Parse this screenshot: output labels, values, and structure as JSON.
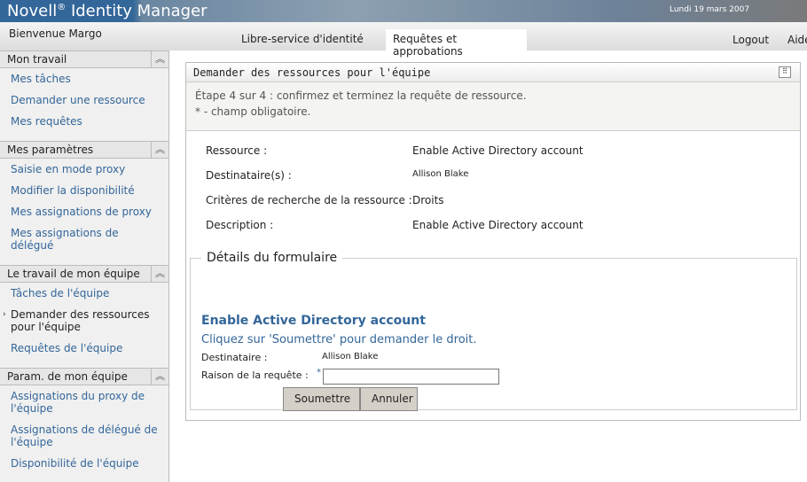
{
  "header": {
    "logo": "Novell",
    "logo_mark": "®",
    "product": " Identity Manager",
    "date": "Lundi 19 mars 2007",
    "welcome": "Bienvenue Margo",
    "tabs": [
      "Libre-service d'identité",
      "Requêtes et approbations"
    ],
    "logout": "Logout",
    "help": "Aide"
  },
  "sidebar": [
    {
      "title": "Mon travail",
      "items": [
        "Mes tâches",
        "Demander une ressource",
        "Mes requêtes"
      ]
    },
    {
      "title": "Mes paramètres",
      "items": [
        "Saisie en mode proxy",
        "Modifier la disponibilité",
        "Mes assignations de proxy",
        "Mes assignations de délégué"
      ]
    },
    {
      "title": "Le travail de mon équipe",
      "items": [
        "Tâches de l'équipe",
        "Demander des ressources pour l'équipe",
        "Requêtes de l'équipe"
      ]
    },
    {
      "title": "Param. de mon équipe",
      "items": [
        "Assignations du proxy de l'équipe",
        "Assignations de délégué de l'équipe",
        "Disponibilité de l'équipe"
      ]
    }
  ],
  "panel": {
    "title": "Demander des ressources pour l'équipe",
    "step": "Étape 4 sur 4 : confirmez et terminez la requête de ressource.",
    "required": "* - champ obligatoire.",
    "fields": [
      {
        "label": "Ressource :",
        "value": "Enable Active Directory account"
      },
      {
        "label": "Destinataire(s) :",
        "value": "Allison Blake"
      },
      {
        "label": "Critères de recherche de la ressource :",
        "value": "Droits"
      },
      {
        "label": "Description :",
        "value": "Enable Active Directory account"
      }
    ],
    "form": {
      "legend": "Détails du formulaire",
      "title": "Enable Active Directory account",
      "subtitle": "Cliquez sur 'Soumettre' pour demander le droit.",
      "recipient_label": "Destinataire :",
      "recipient": "Allison Blake",
      "reason_label": "Raison de la requête :",
      "asterisk": "*",
      "reason_value": "",
      "submit": "Soumettre",
      "cancel": "Annuler"
    }
  }
}
